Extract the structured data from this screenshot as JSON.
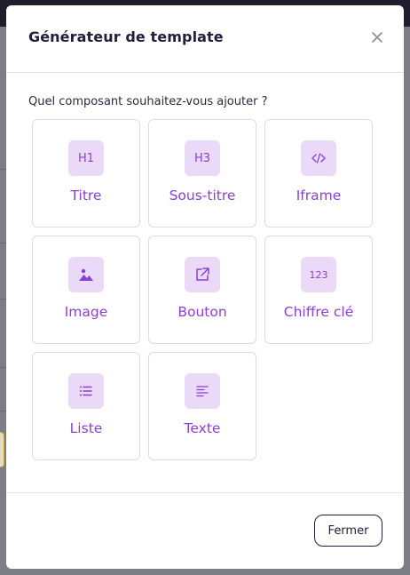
{
  "modal": {
    "title": "Générateur de template",
    "prompt": "Quel composant souhaitez-vous ajouter ?",
    "close_icon": "close-icon"
  },
  "components": [
    {
      "label": "Titre",
      "icon": "h1-icon",
      "glyph": "H1"
    },
    {
      "label": "Sous-titre",
      "icon": "h3-icon",
      "glyph": "H3"
    },
    {
      "label": "Iframe",
      "icon": "code-icon",
      "glyph": "</>"
    },
    {
      "label": "Image",
      "icon": "image-icon",
      "glyph": ""
    },
    {
      "label": "Bouton",
      "icon": "external-link-icon",
      "glyph": ""
    },
    {
      "label": "Chiffre clé",
      "icon": "number-icon",
      "glyph": "123"
    },
    {
      "label": "Liste",
      "icon": "list-icon",
      "glyph": ""
    },
    {
      "label": "Texte",
      "icon": "text-align-icon",
      "glyph": ""
    }
  ],
  "footer": {
    "close_label": "Fermer"
  },
  "colors": {
    "accent": "#8b3fd3",
    "tile_bg": "#ead9f7",
    "text_dark": "#20203a"
  }
}
